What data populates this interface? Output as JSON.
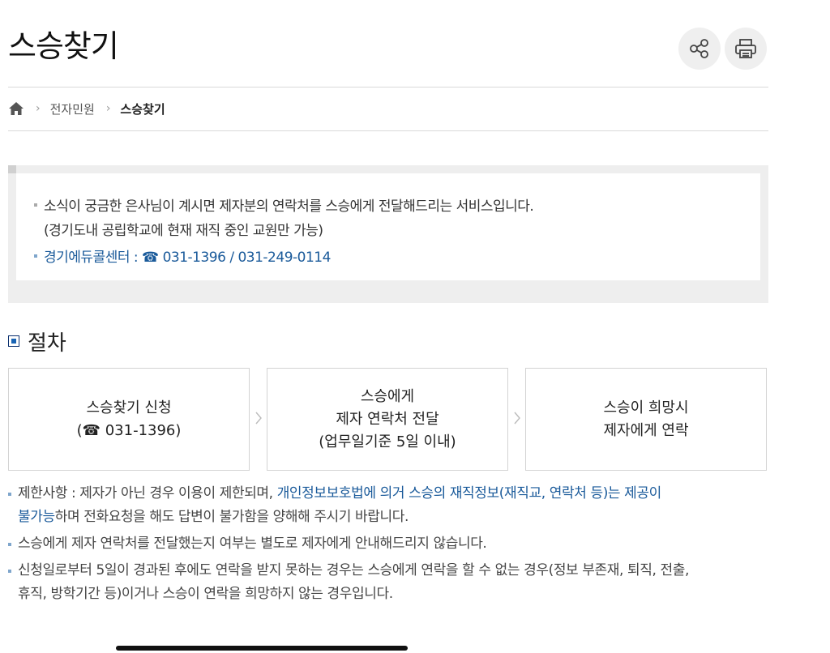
{
  "header": {
    "title": "스승찾기",
    "share_icon": "share-icon",
    "print_icon": "printer-icon"
  },
  "breadcrumb": {
    "home_icon": "home-icon",
    "items": [
      "전자민원",
      "스승찾기"
    ]
  },
  "info": {
    "lines": [
      "소식이 궁금한 은사님이 계시면 제자분의 연락처를 스승에게 전달해드리는 서비스입니다.",
      "(경기도내 공립학교에 현재 재직 중인 교원만 가능)"
    ],
    "contact": "경기에듀콜센터 : ☎ 031-1396 / 031-249-0114"
  },
  "procedure": {
    "title": "절차",
    "steps": [
      {
        "lines": [
          "스승찾기 신청",
          "(☎ 031-1396)"
        ]
      },
      {
        "lines": [
          "스승에게",
          "제자 연락처 전달",
          "(업무일기준 5일 이내)"
        ]
      },
      {
        "lines": [
          "스승이 희망시",
          "제자에게 연락"
        ]
      }
    ]
  },
  "notes": {
    "n1_prefix": "제한사항 : 제자가 아닌 경우 이용이 제한되며, ",
    "n1_highlight_a": "개인정보보호법에 의거 스승의 재직정보(재직교, 연락처 등)는 제공이",
    "n1_highlight_b": "불가능",
    "n1_suffix": "하며 전화요청을 해도 답변이 불가함을 양해해 주시기 바랍니다.",
    "n2": "스승에게 제자 연락처를 전달했는지 여부는 별도로 제자에게 안내해드리지 않습니다.",
    "n3_a": "신청일로부터 5일이 경과된 후에도 연락을 받지 못하는 경우는 스승에게 연락을 할 수 없는 경우(정보 부존재, 퇴직, 전출,",
    "n3_b": "휴직, 방학기간 등)이거나 스승이 연락을 희망하지 않는 경우입니다."
  }
}
